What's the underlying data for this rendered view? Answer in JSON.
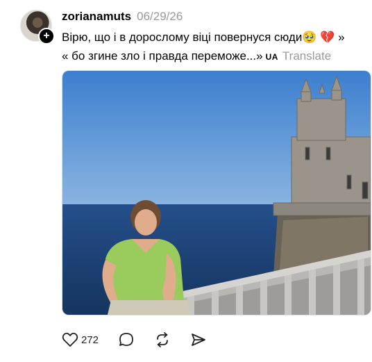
{
  "post": {
    "username": "zorianamuts",
    "date": "06/29/26",
    "caption_line1": "Вірю, що і в дорослому віці повернуся сюди🥹 💔 »",
    "caption_line2": "« бо згине зло і правда переможе...»",
    "language_badge": "UA",
    "translate_label": "Translate",
    "image_alt": "Girl in green t-shirt on a balcony by the sea with a castle on a cliff"
  },
  "actions": {
    "like_count": "272",
    "icons": [
      "heart-icon",
      "comment-icon",
      "repost-icon",
      "share-icon"
    ]
  },
  "colors": {
    "sky": "#4a86cf",
    "sea": "#1f4f8e",
    "shirt": "#9acb5d"
  }
}
